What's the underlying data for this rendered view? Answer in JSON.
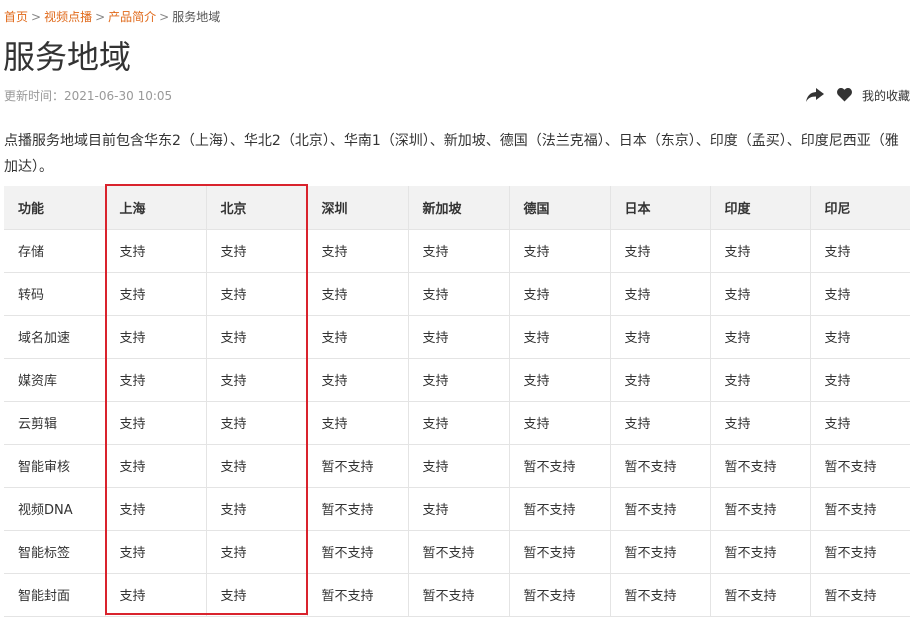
{
  "breadcrumb": {
    "items": [
      "首页",
      "视频点播",
      "产品简介"
    ],
    "separator": ">",
    "current": "服务地域"
  },
  "page_title": "服务地域",
  "meta": {
    "updated_label": "更新时间：",
    "updated_value": "2021-06-30 10:05"
  },
  "actions": {
    "share_icon": "share-arrow-icon",
    "heart_icon": "heart-icon",
    "favorite_label": "我的收藏"
  },
  "intro": "点播服务地域目前包含华东2（上海）、华北2（北京）、华南1（深圳）、新加坡、德国（法兰克福）、日本（东京）、印度（孟买）、印度尼西亚（雅加达）。",
  "table": {
    "headers": [
      "功能",
      "上海",
      "北京",
      "深圳",
      "新加坡",
      "德国",
      "日本",
      "印度",
      "印尼"
    ],
    "rows": [
      [
        "存储",
        "支持",
        "支持",
        "支持",
        "支持",
        "支持",
        "支持",
        "支持",
        "支持"
      ],
      [
        "转码",
        "支持",
        "支持",
        "支持",
        "支持",
        "支持",
        "支持",
        "支持",
        "支持"
      ],
      [
        "域名加速",
        "支持",
        "支持",
        "支持",
        "支持",
        "支持",
        "支持",
        "支持",
        "支持"
      ],
      [
        "媒资库",
        "支持",
        "支持",
        "支持",
        "支持",
        "支持",
        "支持",
        "支持",
        "支持"
      ],
      [
        "云剪辑",
        "支持",
        "支持",
        "支持",
        "支持",
        "支持",
        "支持",
        "支持",
        "支持"
      ],
      [
        "智能审核",
        "支持",
        "支持",
        "暂不支持",
        "支持",
        "暂不支持",
        "暂不支持",
        "暂不支持",
        "暂不支持"
      ],
      [
        "视频DNA",
        "支持",
        "支持",
        "暂不支持",
        "支持",
        "暂不支持",
        "暂不支持",
        "暂不支持",
        "暂不支持"
      ],
      [
        "智能标签",
        "支持",
        "支持",
        "暂不支持",
        "暂不支持",
        "暂不支持",
        "暂不支持",
        "暂不支持",
        "暂不支持"
      ],
      [
        "智能封面",
        "支持",
        "支持",
        "暂不支持",
        "暂不支持",
        "暂不支持",
        "暂不支持",
        "暂不支持",
        "暂不支持"
      ]
    ]
  },
  "colors": {
    "breadcrumb_link": "#e06a1b",
    "highlight_border": "#d9232d",
    "header_bg": "#f2f2f2"
  }
}
